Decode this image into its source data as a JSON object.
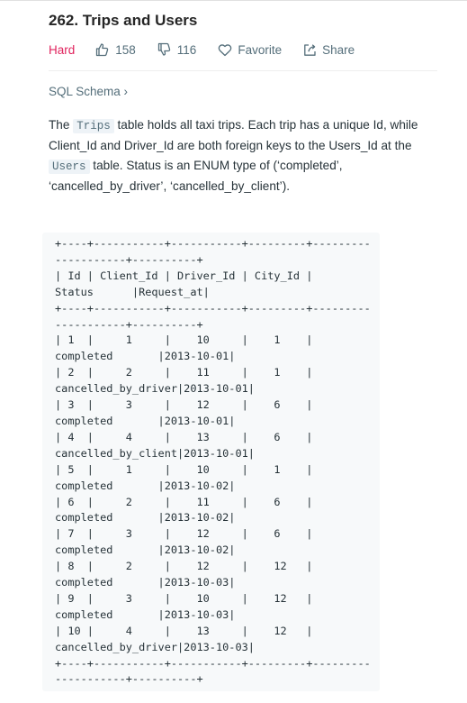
{
  "problem": {
    "title": "262. Trips and Users",
    "difficulty": "Hard",
    "likes": "158",
    "dislikes": "116",
    "favorite_label": "Favorite",
    "share_label": "Share"
  },
  "schema_link": "SQL Schema ›",
  "description": {
    "t1": "The ",
    "code1": "Trips",
    "t2": " table holds all taxi trips. Each trip has a unique Id, while Client_Id and Driver_Id are both foreign keys to the Users_Id at the ",
    "code2": "Users",
    "t3": " table. Status is an ENUM type of (‘completed’, ‘cancelled_by_driver’, ‘cancelled_by_client’)."
  },
  "table_text": "+----+-----------+-----------+---------+---------\n-----------+----------+\n| Id | Client_Id | Driver_Id | City_Id |\nStatus      |Request_at|\n+----+-----------+-----------+---------+---------\n-----------+----------+\n| 1  |     1     |    10     |    1    |\ncompleted       |2013-10-01|\n| 2  |     2     |    11     |    1    |\ncancelled_by_driver|2013-10-01|\n| 3  |     3     |    12     |    6    |\ncompleted       |2013-10-01|\n| 4  |     4     |    13     |    6    |\ncancelled_by_client|2013-10-01|\n| 5  |     1     |    10     |    1    |\ncompleted       |2013-10-02|\n| 6  |     2     |    11     |    6    |\ncompleted       |2013-10-02|\n| 7  |     3     |    12     |    6    |\ncompleted       |2013-10-02|\n| 8  |     2     |    12     |    12   |\ncompleted       |2013-10-03|\n| 9  |     3     |    10     |    12   |\ncompleted       |2013-10-03|\n| 10 |     4     |    13     |    12   |\ncancelled_by_driver|2013-10-03|\n+----+-----------+-----------+---------+---------\n-----------+----------+"
}
